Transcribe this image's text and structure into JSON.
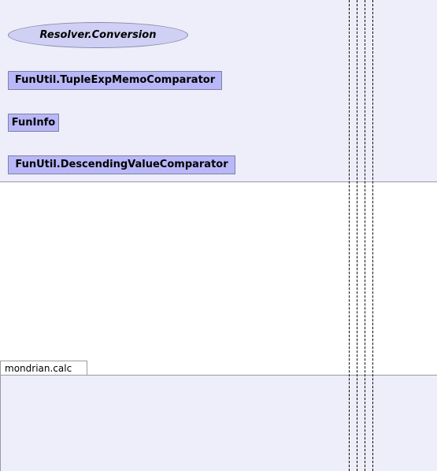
{
  "diagram": {
    "packages": {
      "bottom_tab_label": "mondrian.calc"
    },
    "ellipse_label": "Resolver.Conversion",
    "classes": [
      "FunUtil.TupleExpMemoComparator",
      "FunInfo",
      "FunUtil.DescendingValueComparator"
    ]
  },
  "colors": {
    "package_fill": "#eeeefa",
    "class_fill": "#b8b8f8",
    "ellipse_fill": "#d0d0f5",
    "border": "#9a9aa6"
  }
}
